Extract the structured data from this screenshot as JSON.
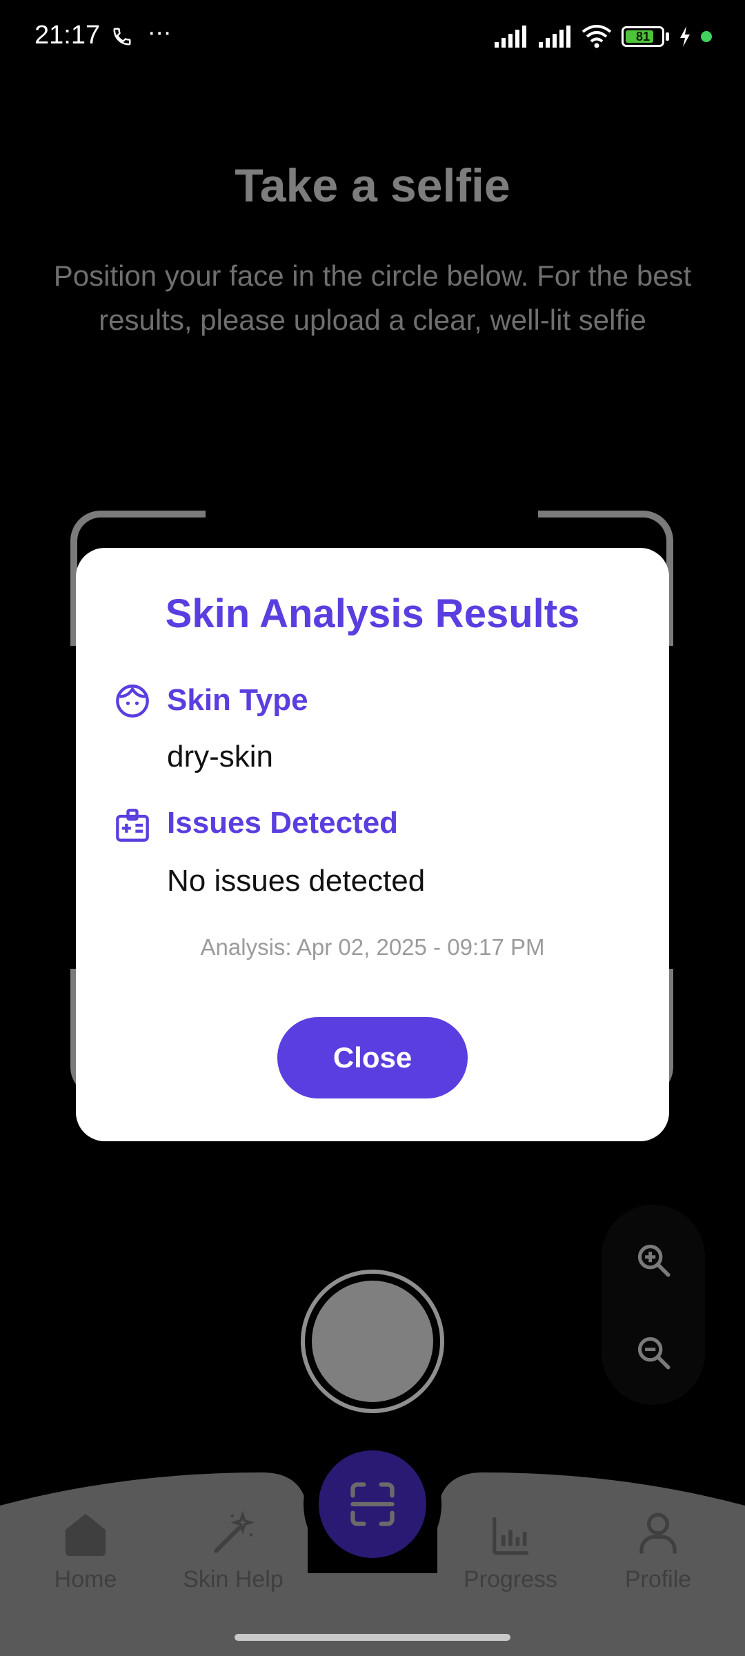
{
  "status_bar": {
    "time": "21:17",
    "battery_level": "81",
    "icons": [
      "phone-call-icon",
      "more-dots-icon",
      "signal-icon",
      "signal-icon",
      "wifi-icon",
      "battery-icon",
      "charging-icon",
      "active-dot-icon"
    ]
  },
  "camera_screen": {
    "title": "Take a selfie",
    "subtitle": "Position your face in the circle below. For the best results, please upload a clear, well-lit selfie",
    "zoom_icons": [
      "zoom-in-icon",
      "zoom-out-icon"
    ]
  },
  "modal": {
    "title": "Skin Analysis Results",
    "skin_type": {
      "heading": "Skin Type",
      "value": "dry-skin",
      "icon": "face-icon"
    },
    "issues": {
      "heading": "Issues Detected",
      "value": "No issues detected",
      "icon": "medical-id-icon"
    },
    "analysis_date": "Analysis: Apr 02, 2025 - 09:17 PM",
    "close_label": "Close"
  },
  "bottom_nav": {
    "items": [
      {
        "label": "Home",
        "icon": "home-icon"
      },
      {
        "label": "Skin Help",
        "icon": "magic-wand-icon"
      },
      {
        "label": "Progress",
        "icon": "bar-chart-icon"
      },
      {
        "label": "Profile",
        "icon": "user-icon"
      }
    ],
    "center_icon": "scan-icon"
  },
  "colors": {
    "accent": "#5b3ee0",
    "background": "#000000",
    "modal_bg": "#ffffff",
    "battery_green": "#4fc43a"
  }
}
